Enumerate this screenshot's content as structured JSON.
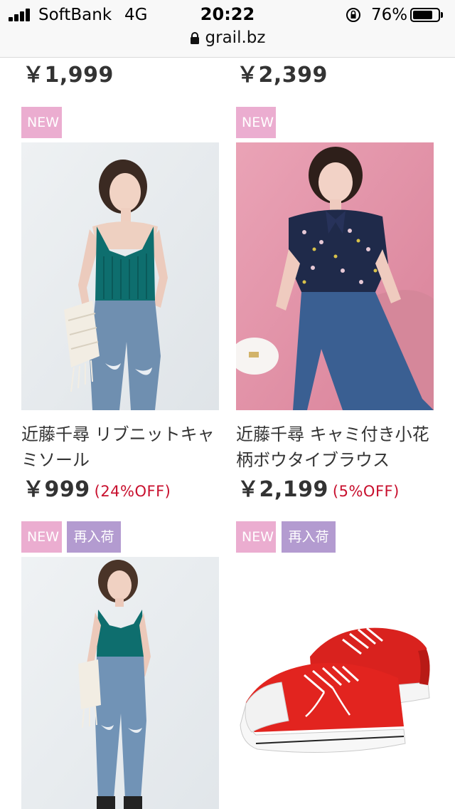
{
  "status_bar": {
    "carrier": "SoftBank",
    "network": "4G",
    "time": "20:22",
    "battery": "76%",
    "battery_level": 0.76
  },
  "browser": {
    "url": "grail.bz"
  },
  "colors": {
    "new_badge": "#ebadd0",
    "restock_badge": "#b39bd0",
    "discount": "#c8102e"
  },
  "previous_row": {
    "left_price": "￥1,999",
    "right_price": "￥2,399"
  },
  "products": [
    {
      "badges": [
        "NEW"
      ],
      "name": "近藤千尋 リブニットキャミソール",
      "price": "￥999",
      "discount": "(24%OFF)"
    },
    {
      "badges": [
        "NEW"
      ],
      "name": "近藤千尋 キャミ付き小花柄ボウタイブラウス",
      "price": "￥2,199",
      "discount": "(5%OFF)"
    },
    {
      "badges": [
        "NEW",
        "再入荷"
      ],
      "name": "",
      "price": "",
      "discount": ""
    },
    {
      "badges": [
        "NEW",
        "再入荷"
      ],
      "name": "",
      "price": "",
      "discount": ""
    }
  ]
}
